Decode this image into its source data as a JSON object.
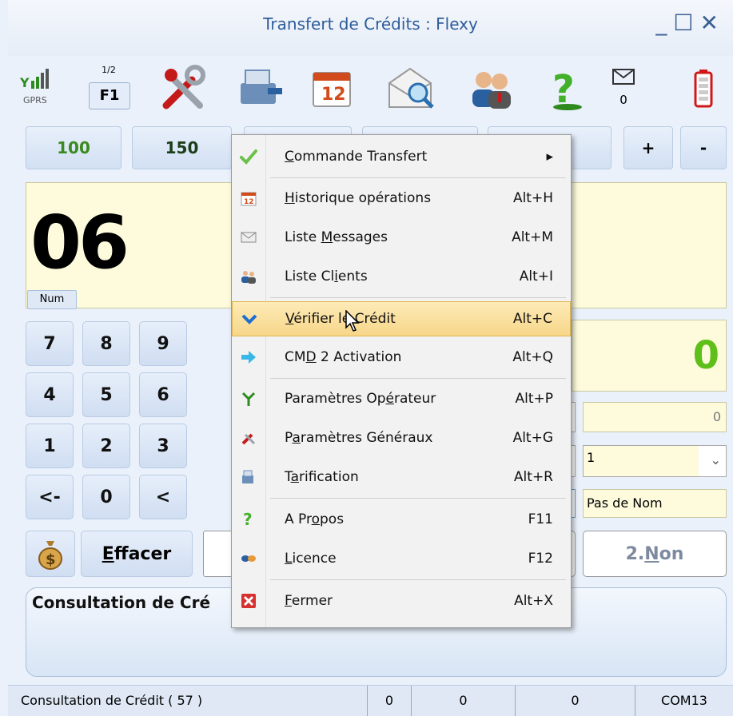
{
  "window": {
    "title": "Transfert de Crédits : Flexy",
    "controls": [
      "_",
      "☐",
      "✕"
    ]
  },
  "toolbar": {
    "signal_label": "GPRS",
    "f1_page": "1/2",
    "f1_label": "F1",
    "message_count": "0",
    "icons": [
      "signal-icon",
      "tools-icon",
      "cash-register-icon",
      "calendar-icon",
      "mail-search-icon",
      "users-icon",
      "help-icon",
      "envelope-icon",
      "battery-icon"
    ]
  },
  "quick_amounts": [
    {
      "label": "100",
      "color": "#3a8a20"
    },
    {
      "label": "150",
      "color": "#1b3d1a"
    }
  ],
  "quick_adjust": {
    "plus": "+",
    "minus": "-"
  },
  "display": {
    "number": "06",
    "mode": "Num"
  },
  "keypad": [
    [
      "7",
      "8",
      "9"
    ],
    [
      "4",
      "5",
      "6"
    ],
    [
      "1",
      "2",
      "3"
    ],
    [
      "<-",
      "0",
      "<"
    ]
  ],
  "actions": {
    "clear": "Effacer",
    "clear_underline": "E",
    "clear_rest": "ffacer",
    "no_prefix": "2. ",
    "no_underline": "N",
    "no_rest": "on"
  },
  "right_panel": {
    "amount": "0",
    "field_value": "0",
    "selected": "1",
    "name": "Pas de Nom"
  },
  "bottom_panel": {
    "title": "Consultation de Cré"
  },
  "status": {
    "message": "Consultation de Crédit ( 57 )",
    "c1": "0",
    "c2": "0",
    "c3": "0",
    "port": "COM13"
  },
  "menu": {
    "items": [
      {
        "pre": "",
        "u": "C",
        "post": "ommande Transfert",
        "shortcut": "▸",
        "icon": "check-icon"
      },
      {
        "pre": "",
        "u": "H",
        "post": "istorique opérations",
        "shortcut": "Alt+H",
        "icon": "calendar-icon"
      },
      {
        "pre": "Liste ",
        "u": "M",
        "post": "essages",
        "shortcut": "Alt+M",
        "icon": "envelope-icon"
      },
      {
        "pre": "Liste Cl",
        "u": "i",
        "post": "ents",
        "shortcut": "Alt+I",
        "icon": "users-icon"
      },
      {
        "pre": "",
        "u": "V",
        "post": "érifier le Crédit",
        "shortcut": "Alt+C",
        "icon": "chevron-down-icon"
      },
      {
        "pre": "CM",
        "u": "D",
        "post": " 2 Activation",
        "shortcut": "Alt+Q",
        "icon": "arrow-right-icon"
      },
      {
        "pre": "Paramètres Op",
        "u": "é",
        "post": "rateur",
        "shortcut": "Alt+P",
        "icon": "antenna-icon"
      },
      {
        "pre": "P",
        "u": "a",
        "post": "ramètres Généraux",
        "shortcut": "Alt+G",
        "icon": "tools-icon"
      },
      {
        "pre": "T",
        "u": "a",
        "post": "rification",
        "shortcut": "Alt+R",
        "icon": "cash-register-icon"
      },
      {
        "pre": "A Pr",
        "u": "o",
        "post": "pos",
        "shortcut": "F11",
        "icon": "help-icon"
      },
      {
        "pre": "",
        "u": "L",
        "post": "icence",
        "shortcut": "F12",
        "icon": "handshake-icon"
      },
      {
        "pre": "",
        "u": "F",
        "post": "ermer",
        "shortcut": "Alt+X",
        "icon": "close-icon"
      }
    ]
  }
}
